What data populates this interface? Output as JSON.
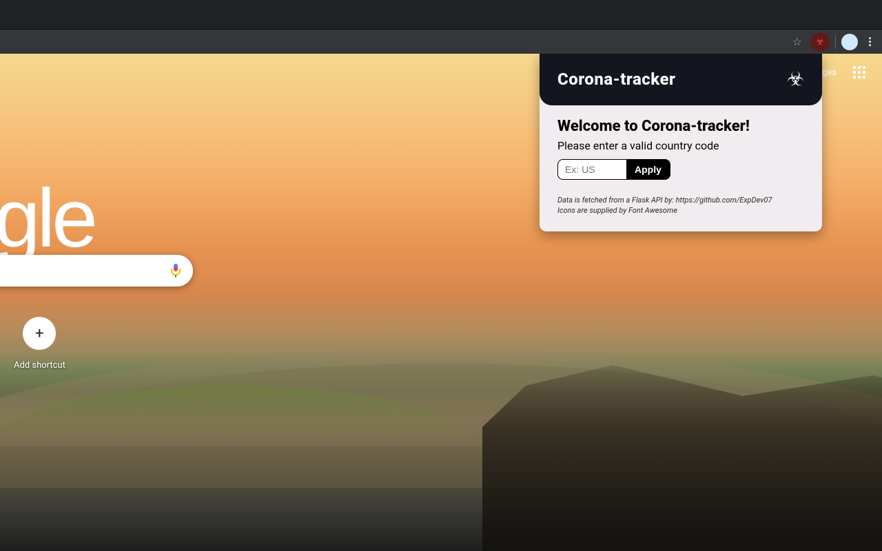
{
  "browser": {
    "avatar_present": true
  },
  "ntp": {
    "logo_text": "Google",
    "links": {
      "images_label": "ges"
    },
    "shortcut": {
      "add_label": "Add shortcut",
      "plus_symbol": "+"
    },
    "search": {
      "placeholder": ""
    }
  },
  "popup": {
    "title": "Corona-tracker",
    "welcome": "Welcome to Corona-tracker!",
    "subtitle": "Please enter a valid country code",
    "input_placeholder": "Ex: US",
    "apply_label": "Apply",
    "credits_line1": "Data is fetched from a Flask API by: https://github.com/ExpDev07",
    "credits_line2": "Icons are supplied by Font Awesome"
  }
}
